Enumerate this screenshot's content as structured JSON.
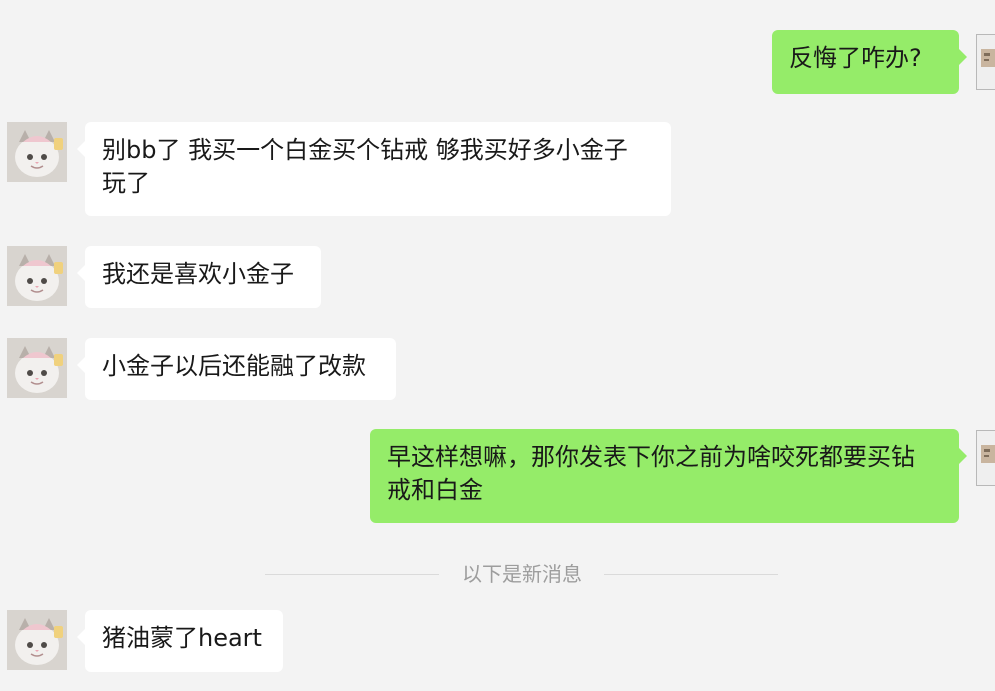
{
  "chat": {
    "messages": [
      {
        "side": "right",
        "text": "反悔了咋办?"
      },
      {
        "side": "left",
        "text": "别bb了 我买一个白金买个钻戒 够我买好多小金子\n玩了"
      },
      {
        "side": "left",
        "text": "我还是喜欢小金子"
      },
      {
        "side": "left",
        "text": "小金子以后还能融了改款"
      },
      {
        "side": "right",
        "text": "早这样想嘛，那你发表下你之前为啥咬死都要买钻\n戒和白金"
      },
      {
        "side": "left",
        "text": "猪油蒙了heart"
      }
    ],
    "divider": {
      "label": "以下是新消息"
    }
  },
  "colors": {
    "background": "#f3f3f3",
    "left_bubble": "#ffffff",
    "right_bubble": "#95ec69",
    "text": "#191919",
    "divider_text": "#9d9d9d"
  },
  "icons": {
    "left_avatar": "cat-avatar-icon",
    "right_avatar": "user-avatar-icon"
  }
}
